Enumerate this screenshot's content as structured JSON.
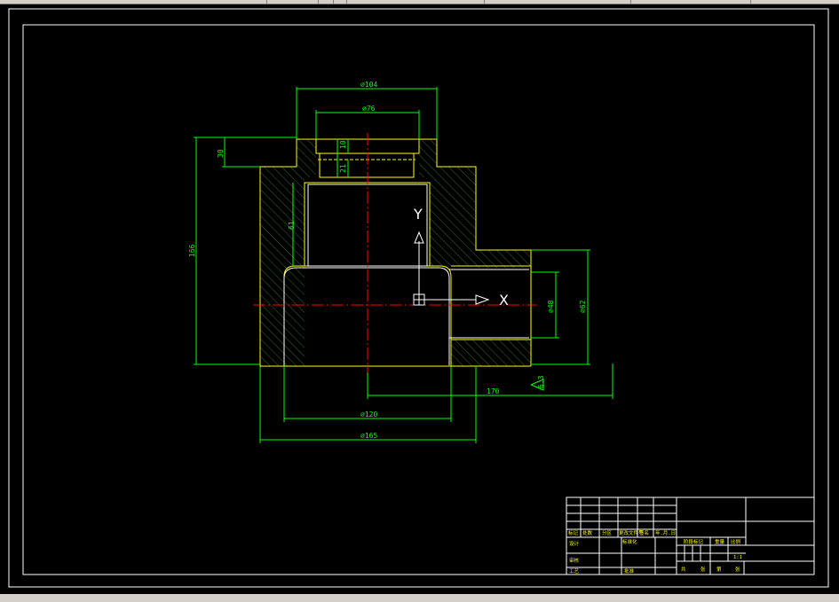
{
  "colors": {
    "background": "#000000",
    "frame": "#ffffff",
    "dimension": "#00ff00",
    "outline": "#ffff00",
    "centerline": "#ff0000",
    "hatch": "#2e6b3a",
    "ucs": "#ffffff"
  },
  "dimensions": {
    "outer_top": "⌀104",
    "inner_top": "⌀76",
    "step_top": "30",
    "height_total": "166",
    "groove_1": "10",
    "groove_2": "21",
    "bore_depth": "61",
    "side_inner": "⌀48",
    "side_outer": "⌀62",
    "offset": "170",
    "bottom_inner": "⌀120",
    "bottom_outer": "⌀165",
    "roughness": "6.3"
  },
  "ucs": {
    "y_label": "Y",
    "x_label": "X"
  },
  "title_block": {
    "header_cells": [
      "标记",
      "处数",
      "分区",
      "更改文件号",
      "签名",
      "年.月.日"
    ],
    "design_label": "设计",
    "standard_label": "标准化",
    "review_label": "审核",
    "process_label": "工艺",
    "approve_label": "批准",
    "stage_label": "阶段标记",
    "weight_label": "重量",
    "scale_label": "比例",
    "scale_value": "1:1",
    "sheet_total_label": "共",
    "sheet_label": "张",
    "page_label": "第",
    "page_sheet_label": "张"
  }
}
